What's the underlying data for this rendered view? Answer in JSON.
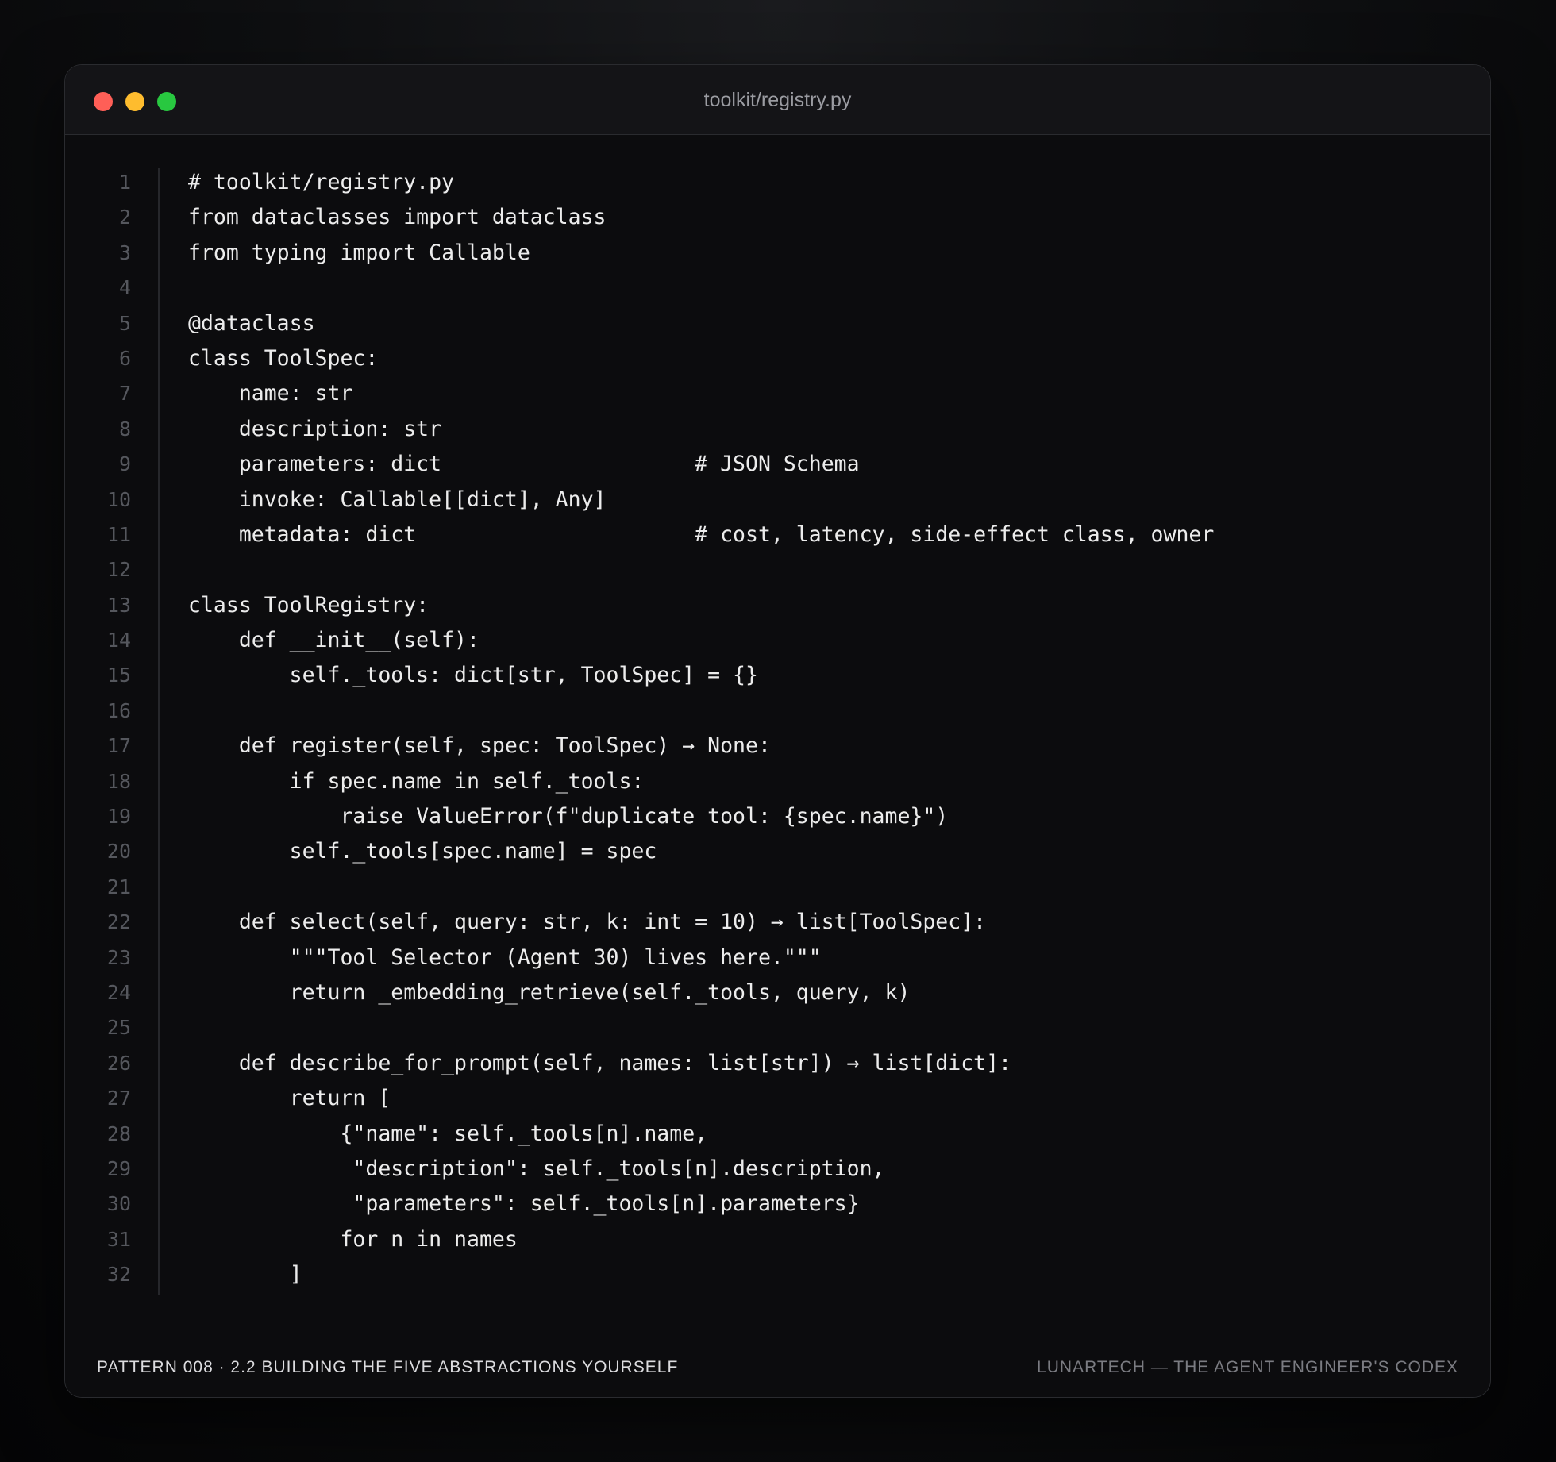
{
  "window": {
    "title": "toolkit/registry.py"
  },
  "editor": {
    "line_numbers": [
      "1",
      "2",
      "3",
      "4",
      "5",
      "6",
      "7",
      "8",
      "9",
      "10",
      "11",
      "12",
      "13",
      "14",
      "15",
      "16",
      "17",
      "18",
      "19",
      "20",
      "21",
      "22",
      "23",
      "24",
      "25",
      "26",
      "27",
      "28",
      "29",
      "30",
      "31",
      "32"
    ],
    "lines": [
      "# toolkit/registry.py",
      "from dataclasses import dataclass",
      "from typing import Callable",
      "",
      "@dataclass",
      "class ToolSpec:",
      "    name: str",
      "    description: str",
      "    parameters: dict                    # JSON Schema",
      "    invoke: Callable[[dict], Any]",
      "    metadata: dict                      # cost, latency, side-effect class, owner",
      "",
      "class ToolRegistry:",
      "    def __init__(self):",
      "        self._tools: dict[str, ToolSpec] = {}",
      "",
      "    def register(self, spec: ToolSpec) → None:",
      "        if spec.name in self._tools:",
      "            raise ValueError(f\"duplicate tool: {spec.name}\")",
      "        self._tools[spec.name] = spec",
      "",
      "    def select(self, query: str, k: int = 10) → list[ToolSpec]:",
      "        \"\"\"Tool Selector (Agent 30) lives here.\"\"\"",
      "        return _embedding_retrieve(self._tools, query, k)",
      "",
      "    def describe_for_prompt(self, names: list[str]) → list[dict]:",
      "        return [",
      "            {\"name\": self._tools[n].name,",
      "             \"description\": self._tools[n].description,",
      "             \"parameters\": self._tools[n].parameters}",
      "            for n in names",
      "        ]"
    ]
  },
  "footer": {
    "left": "PATTERN 008 · 2.2 BUILDING THE FIVE ABSTRACTIONS YOURSELF",
    "right": "LUNARTECH — THE AGENT ENGINEER'S CODEX"
  },
  "colors": {
    "close": "#ff5f57",
    "minimize": "#febc2e",
    "maximize": "#28c840",
    "code_text": "#ececec",
    "line_number": "#55575d"
  }
}
